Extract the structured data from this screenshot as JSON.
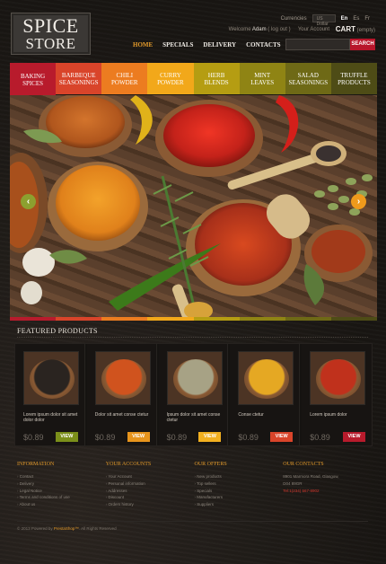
{
  "brand": {
    "logo_line1": "SPICE",
    "logo_line2": "STORE"
  },
  "topbar": {
    "currencies_label": "Currencies",
    "currency_value": "US Dollar",
    "languages": [
      "En",
      "Es",
      "Fr"
    ],
    "active_language": "En"
  },
  "welcome": {
    "prefix": "Welcome",
    "user": "Adam",
    "logout": "( log out )"
  },
  "account": {
    "label": "Your Account",
    "cart_label": "CART",
    "cart_state": "(empty)"
  },
  "nav": {
    "items": [
      "HOME",
      "SPECIALS",
      "DELIVERY",
      "CONTACTS"
    ],
    "active": "HOME"
  },
  "search": {
    "button": "SEARCH",
    "placeholder": ""
  },
  "categories": [
    {
      "line1": "Baking",
      "line2": "Spices",
      "color": "#b81b2c"
    },
    {
      "line1": "Barbeque",
      "line2": "Seasonings",
      "color": "#d9442a"
    },
    {
      "line1": "Chili",
      "line2": "Powder",
      "color": "#ec7c20"
    },
    {
      "line1": "Curry",
      "line2": "Powder",
      "color": "#f2a81a"
    },
    {
      "line1": "Herb",
      "line2": "Blends",
      "color": "#b59d12"
    },
    {
      "line1": "Mint",
      "line2": "Leaves",
      "color": "#8f8414"
    },
    {
      "line1": "Salad",
      "line2": "Seasonings",
      "color": "#6e6916"
    },
    {
      "line1": "Truffle",
      "line2": "Products",
      "color": "#4e4c16"
    }
  ],
  "hero": {
    "prev": "‹",
    "next": "›"
  },
  "hero_bar_colors": [
    "#b81b2c",
    "#d9442a",
    "#ec7c20",
    "#f2a81a",
    "#b59d12",
    "#8f8414",
    "#6e6916",
    "#4e4c16"
  ],
  "featured": {
    "title": "FEATURED PRODUCTS",
    "products": [
      {
        "desc": "Lorem ipsum dolor sit amet dolor dolor",
        "price": "$0.89",
        "view": "VIEW",
        "btn_color": "#7b8f1a",
        "spice": "#2a2420"
      },
      {
        "desc": "Dolor sit amet conse ctetur",
        "price": "$0.89",
        "view": "VIEW",
        "btn_color": "#e7941c",
        "spice": "#d0531e"
      },
      {
        "desc": "Ipsum dolor sit amet conse ctetur",
        "price": "$0.89",
        "view": "VIEW",
        "btn_color": "#f2b020",
        "spice": "#a7a285"
      },
      {
        "desc": "Conse ctetur",
        "price": "$0.89",
        "view": "VIEW",
        "btn_color": "#d9442a",
        "spice": "#e5a823"
      },
      {
        "desc": "Lorem ipsum dolor",
        "price": "$0.89",
        "view": "VIEW",
        "btn_color": "#b81b2c",
        "spice": "#c0311c"
      }
    ]
  },
  "footer": {
    "information": {
      "title": "INFORMATION",
      "items": [
        "Contact",
        "Delivery",
        "Legal Notice",
        "Terms and conditions of use",
        "About us"
      ]
    },
    "accounts": {
      "title": "YOUR ACCOUNTS",
      "items": [
        "Your Account",
        "Personal information",
        "Addresses",
        "Discount",
        "Orders history"
      ]
    },
    "offers": {
      "title": "OUR OFFERS",
      "items": [
        "New products",
        "Top sellers",
        "Specials",
        "Manufacturers",
        "Suppliers"
      ]
    },
    "contacts": {
      "title": "OUR CONTACTS",
      "address1": "8901 Marmora Road, Glasgow,",
      "address2": "D04 89GR",
      "phone": "Tel:1(234) 567-8902"
    }
  },
  "copyright": {
    "text": "© 2013 Powered by",
    "brand": "PrestaShop™",
    "suffix": ". All Rights Reserved"
  }
}
